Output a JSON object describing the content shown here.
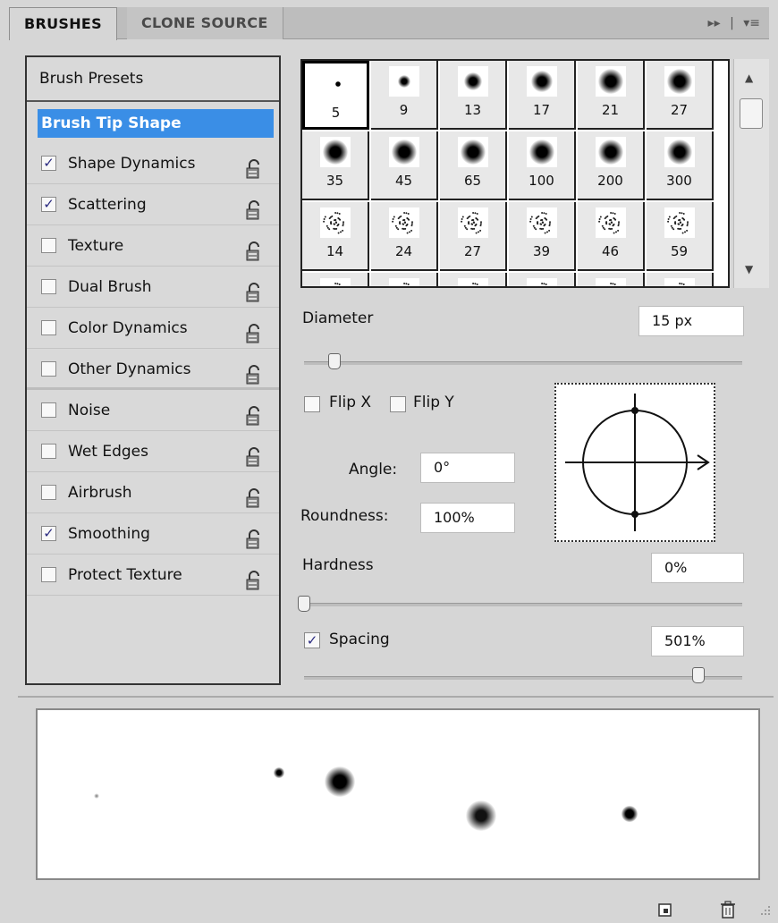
{
  "tabs": {
    "brushes": "BRUSHES",
    "clone_source": "CLONE SOURCE",
    "menu_icons": [
      "▸▸",
      "|",
      "▾≡"
    ]
  },
  "left": {
    "presets": "Brush Presets",
    "tip_shape": "Brush Tip Shape",
    "options": [
      {
        "label": "Shape Dynamics",
        "checked": "✓"
      },
      {
        "label": "Scattering",
        "checked": "✓"
      },
      {
        "label": "Texture",
        "checked": ""
      },
      {
        "label": "Dual Brush",
        "checked": ""
      },
      {
        "label": "Color Dynamics",
        "checked": ""
      },
      {
        "label": "Other Dynamics",
        "checked": ""
      },
      {
        "label": "Noise",
        "checked": ""
      },
      {
        "label": "Wet Edges",
        "checked": ""
      },
      {
        "label": "Airbrush",
        "checked": ""
      },
      {
        "label": "Smoothing",
        "checked": "✓"
      },
      {
        "label": "Protect Texture",
        "checked": ""
      }
    ]
  },
  "grid": {
    "sizes": [
      "5",
      "9",
      "13",
      "17",
      "21",
      "27",
      "35",
      "45",
      "65",
      "100",
      "200",
      "300",
      "14",
      "24",
      "27",
      "39",
      "46",
      "59"
    ]
  },
  "controls": {
    "diameter_label": "Diameter",
    "diameter_value": "15 px",
    "flip_x": "Flip X",
    "flip_y": "Flip Y",
    "angle_label": "Angle:",
    "angle_value": "0°",
    "roundness_label": "Roundness:",
    "roundness_value": "100%",
    "hardness_label": "Hardness",
    "hardness_value": "0%",
    "spacing_label": "Spacing",
    "spacing_value": "501%",
    "spacing_checked": "✓"
  }
}
